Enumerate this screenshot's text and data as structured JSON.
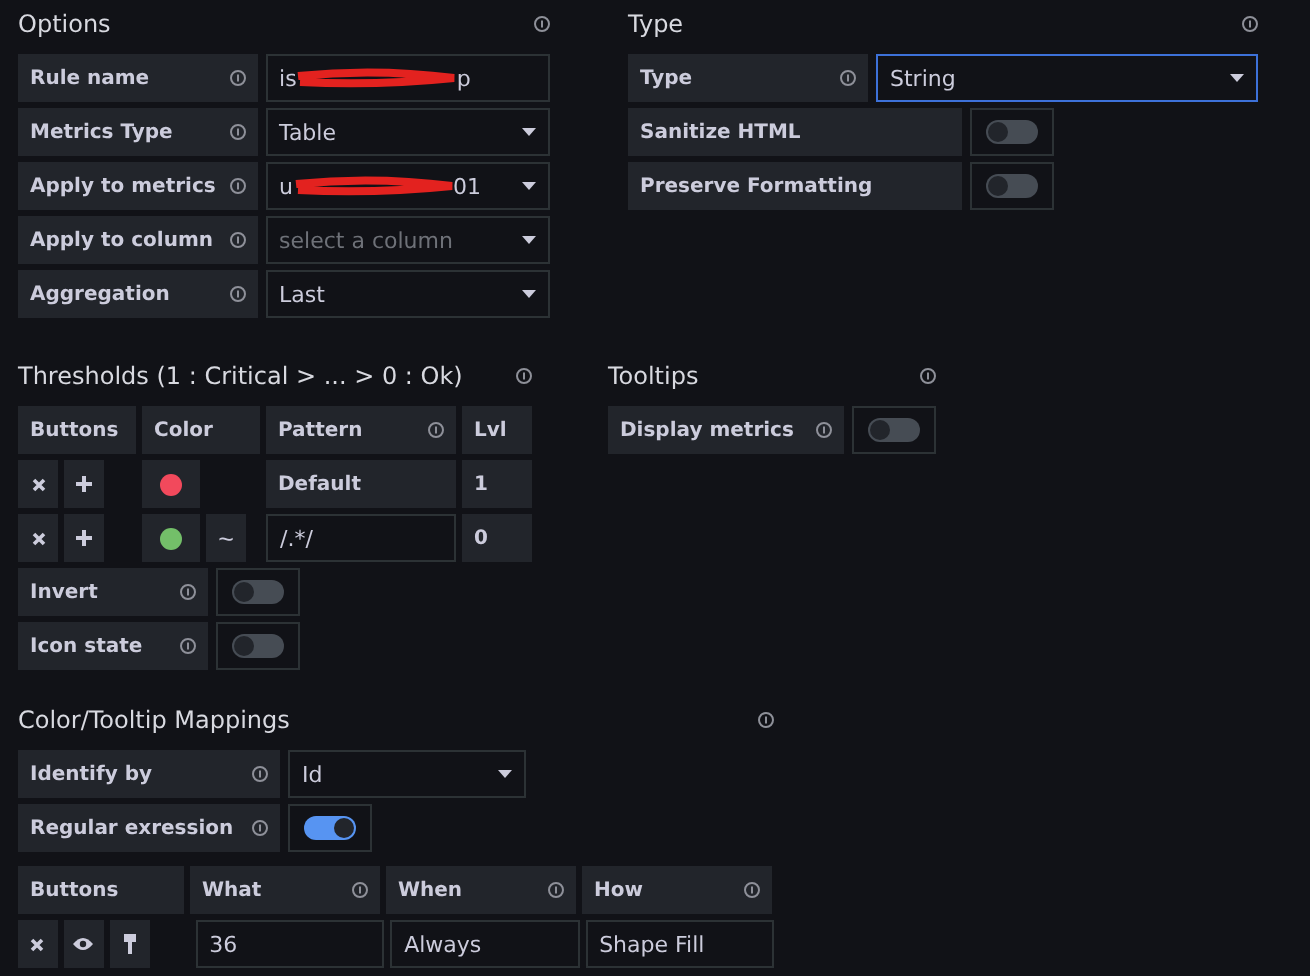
{
  "options": {
    "title": "Options",
    "fields": [
      {
        "kind": "text",
        "label": "Rule name",
        "info": true,
        "value_start": "is",
        "value_end": "p",
        "redacted": true
      },
      {
        "kind": "select",
        "label": "Metrics Type",
        "info": true,
        "value": "Table"
      },
      {
        "kind": "select",
        "label": "Apply to metrics",
        "info": true,
        "value_start": "u",
        "value_end": "01",
        "redacted": true
      },
      {
        "kind": "select",
        "label": "Apply to column",
        "info": true,
        "placeholder": "select a column"
      },
      {
        "kind": "select",
        "label": "Aggregation",
        "info": true,
        "value": "Last"
      }
    ]
  },
  "type": {
    "title": "Type",
    "fields": [
      {
        "kind": "select",
        "label": "Type",
        "info": true,
        "value": "String",
        "focused": true
      },
      {
        "kind": "toggle",
        "label": "Sanitize HTML",
        "info": false,
        "on": false
      },
      {
        "kind": "toggle",
        "label": "Preserve Formatting",
        "info": false,
        "on": false
      }
    ]
  },
  "thresholds": {
    "title": "Thresholds (1 : Critical > ... > 0 : Ok)",
    "columns": [
      {
        "label": "Buttons",
        "info": false
      },
      {
        "label": "Color",
        "info": false
      },
      {
        "label": "Pattern",
        "info": true
      },
      {
        "label": "Lvl",
        "info": false
      }
    ],
    "rows": [
      {
        "color": "#f2495c",
        "pattern": "Default",
        "editable": false,
        "lvl": "1"
      },
      {
        "color": "#73bf69",
        "tilde": "~",
        "pattern": "/.*/",
        "editable": true,
        "lvl": "0"
      }
    ],
    "toggles": [
      {
        "kind": "toggle",
        "label": "Invert",
        "info": true,
        "on": false
      },
      {
        "kind": "toggle",
        "label": "Icon state",
        "info": true,
        "on": false
      }
    ]
  },
  "tooltips": {
    "title": "Tooltips",
    "fields": [
      {
        "kind": "toggle",
        "label": "Display metrics",
        "info": true,
        "on": false
      }
    ]
  },
  "mappings": {
    "title": "Color/Tooltip Mappings",
    "fields": [
      {
        "kind": "select",
        "label": "Identify by",
        "info": true,
        "value": "Id"
      },
      {
        "kind": "toggle",
        "label": "Regular exression",
        "info": true,
        "on": true
      }
    ],
    "columns": [
      {
        "label": "Buttons",
        "info": false
      },
      {
        "label": "What",
        "info": true
      },
      {
        "label": "When",
        "info": true
      },
      {
        "label": "How",
        "info": true
      }
    ],
    "rows": [
      {
        "what": "36",
        "when": "Always",
        "how": "Shape Fill"
      }
    ]
  }
}
